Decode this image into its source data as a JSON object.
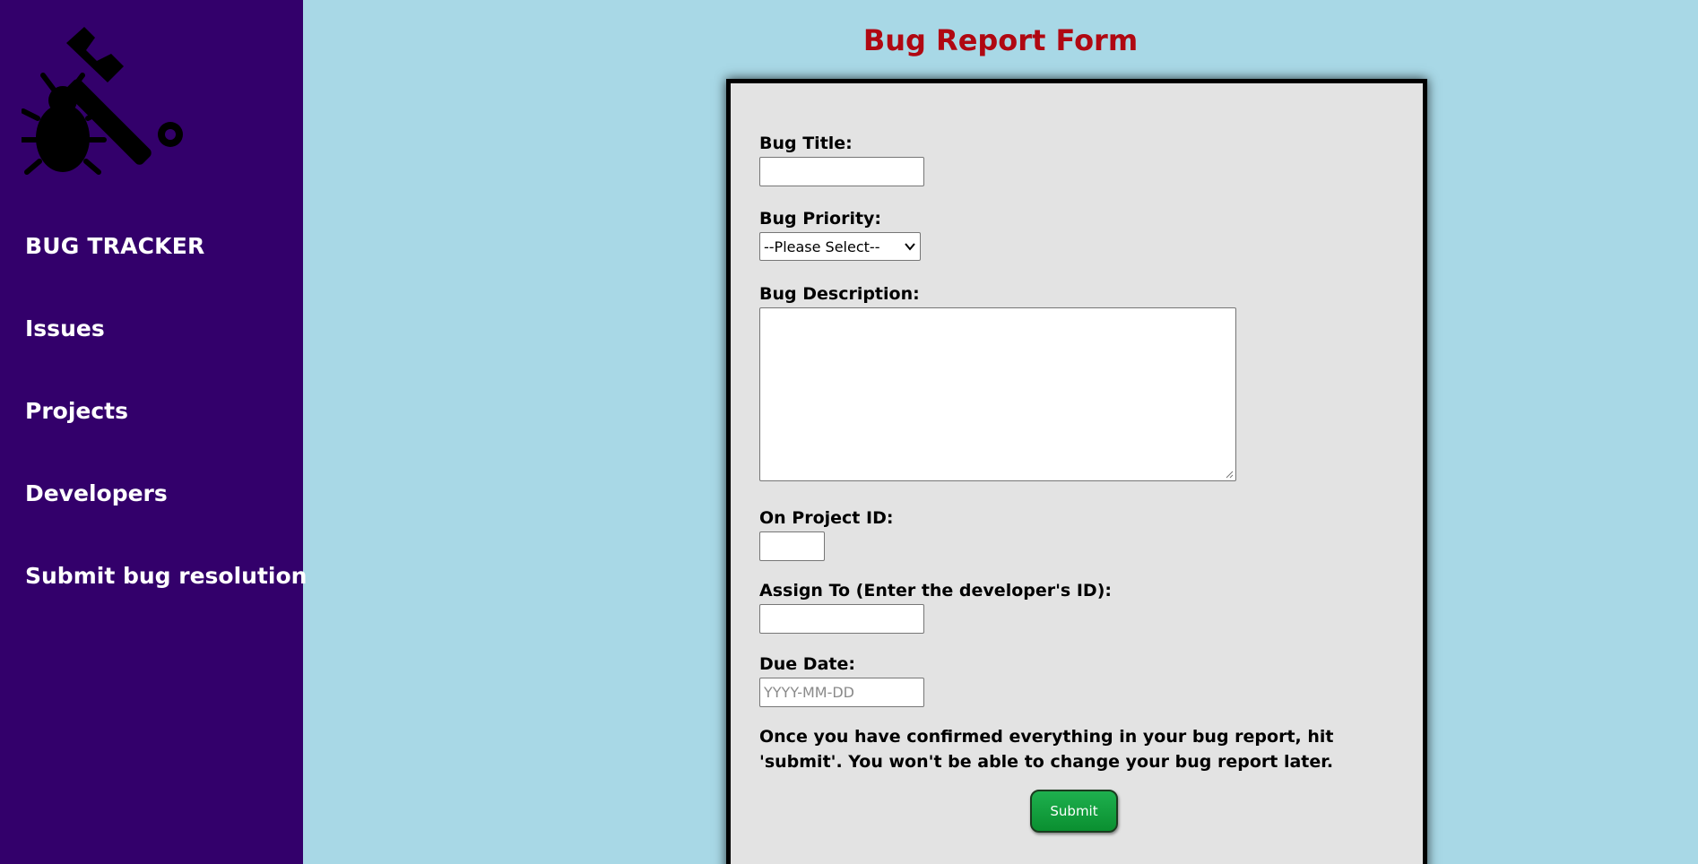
{
  "sidebar": {
    "logo_icon": "bug-wrench-icon",
    "brand": "BUG TRACKER",
    "nav": [
      {
        "label": "Issues"
      },
      {
        "label": "Projects"
      },
      {
        "label": "Developers"
      },
      {
        "label": "Submit bug resolution"
      }
    ]
  },
  "page": {
    "title": "Bug Report Form"
  },
  "form": {
    "bug_title": {
      "label": "Bug Title:",
      "value": ""
    },
    "bug_priority": {
      "label": "Bug Priority:",
      "selected": "--Please Select--"
    },
    "bug_description": {
      "label": "Bug Description:",
      "value": ""
    },
    "project_id": {
      "label": "On Project ID:",
      "value": ""
    },
    "assign_to": {
      "label": "Assign To (Enter the developer's ID):",
      "value": ""
    },
    "due_date": {
      "label": "Due Date:",
      "placeholder": "YYYY-MM-DD"
    },
    "note": "Once you have confirmed everything in your bug report, hit 'submit'. You won't be able to change your bug report later.",
    "submit_label": "Submit"
  },
  "colors": {
    "sidebar_bg": "#33006b",
    "page_bg": "#a8d8e6",
    "title": "#b00812",
    "card_bg": "#e3e3e3",
    "submit_bg": "#13a03f"
  }
}
